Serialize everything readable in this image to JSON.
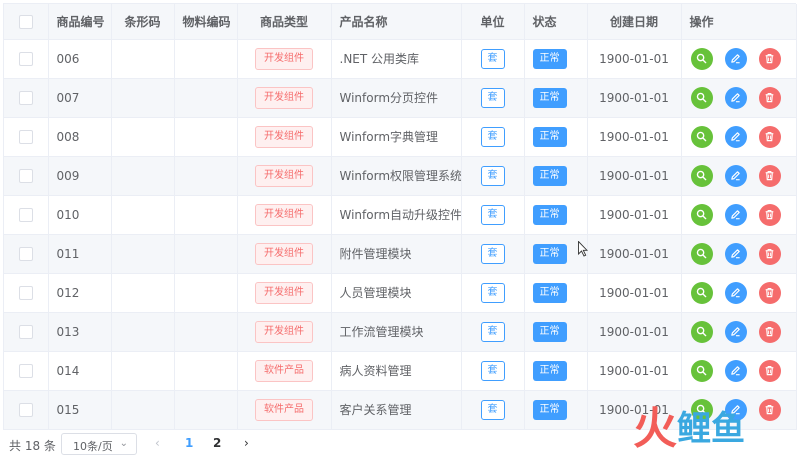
{
  "columns": {
    "product_no": "商品编号",
    "barcode": "条形码",
    "material_code": "物料编码",
    "product_type": "商品类型",
    "product_name": "产品名称",
    "unit": "单位",
    "status": "状态",
    "created": "创建日期",
    "actions": "操作"
  },
  "rows": [
    {
      "no": "006",
      "barcode": "",
      "material": "",
      "type": "开发组件",
      "name": ".NET 公用类库",
      "unit": "套",
      "status": "正常",
      "date": "1900-01-01"
    },
    {
      "no": "007",
      "barcode": "",
      "material": "",
      "type": "开发组件",
      "name": "Winform分页控件",
      "unit": "套",
      "status": "正常",
      "date": "1900-01-01"
    },
    {
      "no": "008",
      "barcode": "",
      "material": "",
      "type": "开发组件",
      "name": "Winform字典管理",
      "unit": "套",
      "status": "正常",
      "date": "1900-01-01"
    },
    {
      "no": "009",
      "barcode": "",
      "material": "",
      "type": "开发组件",
      "name": "Winform权限管理系统",
      "unit": "套",
      "status": "正常",
      "date": "1900-01-01"
    },
    {
      "no": "010",
      "barcode": "",
      "material": "",
      "type": "开发组件",
      "name": "Winform自动升级控件",
      "unit": "套",
      "status": "正常",
      "date": "1900-01-01"
    },
    {
      "no": "011",
      "barcode": "",
      "material": "",
      "type": "开发组件",
      "name": "附件管理模块",
      "unit": "套",
      "status": "正常",
      "date": "1900-01-01"
    },
    {
      "no": "012",
      "barcode": "",
      "material": "",
      "type": "开发组件",
      "name": "人员管理模块",
      "unit": "套",
      "status": "正常",
      "date": "1900-01-01"
    },
    {
      "no": "013",
      "barcode": "",
      "material": "",
      "type": "开发组件",
      "name": "工作流管理模块",
      "unit": "套",
      "status": "正常",
      "date": "1900-01-01"
    },
    {
      "no": "014",
      "barcode": "",
      "material": "",
      "type": "软件产品",
      "name": "病人资料管理",
      "unit": "套",
      "status": "正常",
      "date": "1900-01-01"
    },
    {
      "no": "015",
      "barcode": "",
      "material": "",
      "type": "软件产品",
      "name": "客户关系管理",
      "unit": "套",
      "status": "正常",
      "date": "1900-01-01"
    }
  ],
  "pagination": {
    "total": "共 18 条",
    "page_size": "10条/页",
    "pages": [
      "1",
      "2"
    ],
    "current_page": "1"
  },
  "watermark": {
    "char1": "火",
    "char2": "鲤",
    "char3": "鱼"
  },
  "icons": {
    "view": "search-icon",
    "edit": "edit-icon",
    "delete": "delete-icon"
  },
  "colors": {
    "primary": "#409eff",
    "success": "#67c23a",
    "danger": "#f56c6c"
  }
}
